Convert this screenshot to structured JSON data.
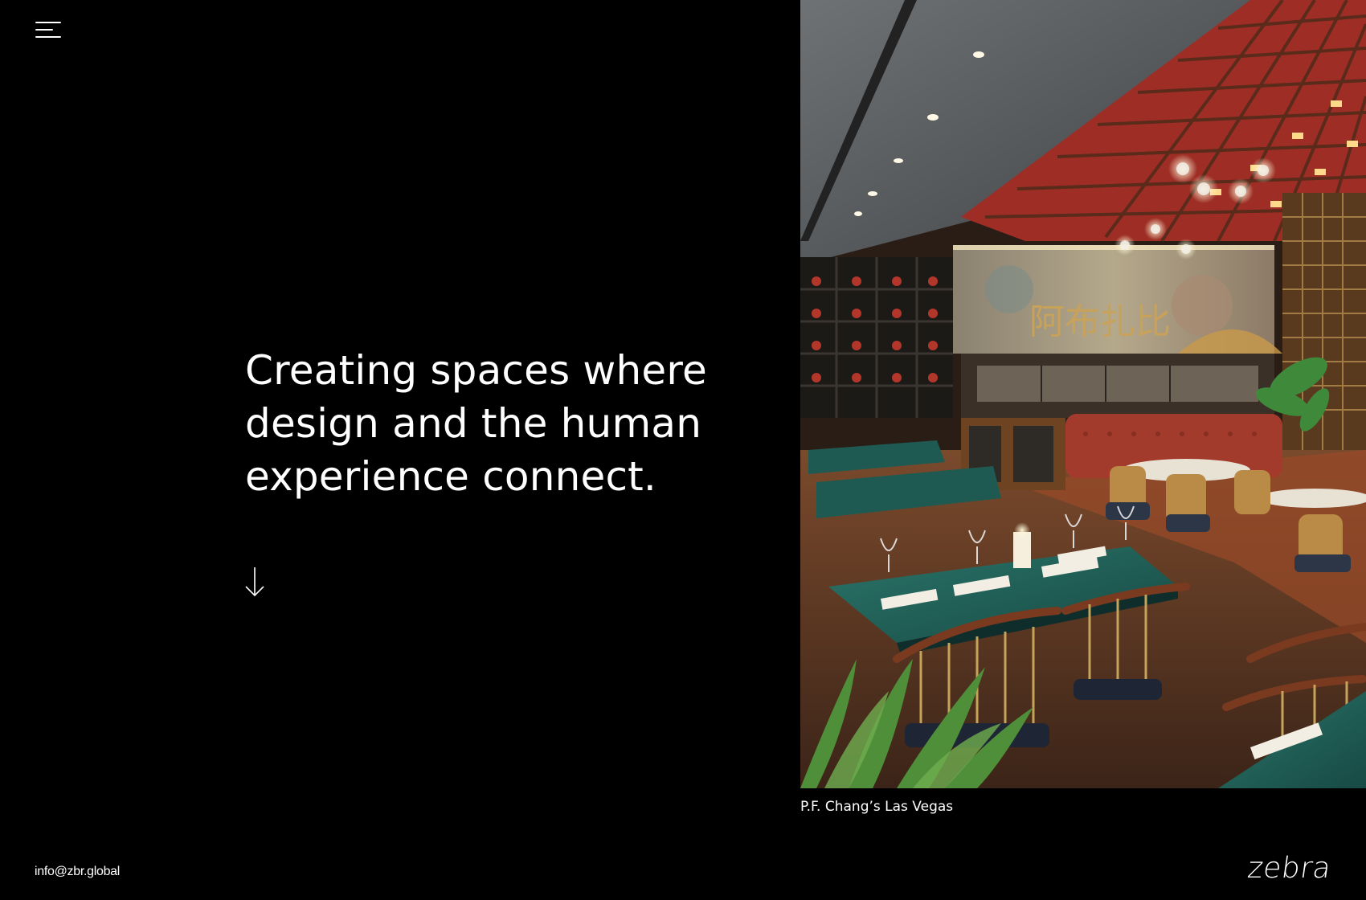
{
  "header": {
    "menu_icon": "hamburger-menu-icon"
  },
  "hero": {
    "lines": [
      "Creating spaces where",
      "design and the human",
      "experience connect."
    ],
    "scroll_icon": "arrow-down-icon"
  },
  "feature": {
    "caption": "P.F. Chang’s Las Vegas",
    "signage_text": "阿布扎比"
  },
  "footer": {
    "email": "info@zbr.global",
    "logo": "zebra"
  },
  "colors": {
    "background": "#000000",
    "text": "#ffffff",
    "ceiling_red": "#b0352a",
    "table_teal": "#1d5a52",
    "booth_red": "#a33b2c",
    "wood": "#7a4526"
  }
}
